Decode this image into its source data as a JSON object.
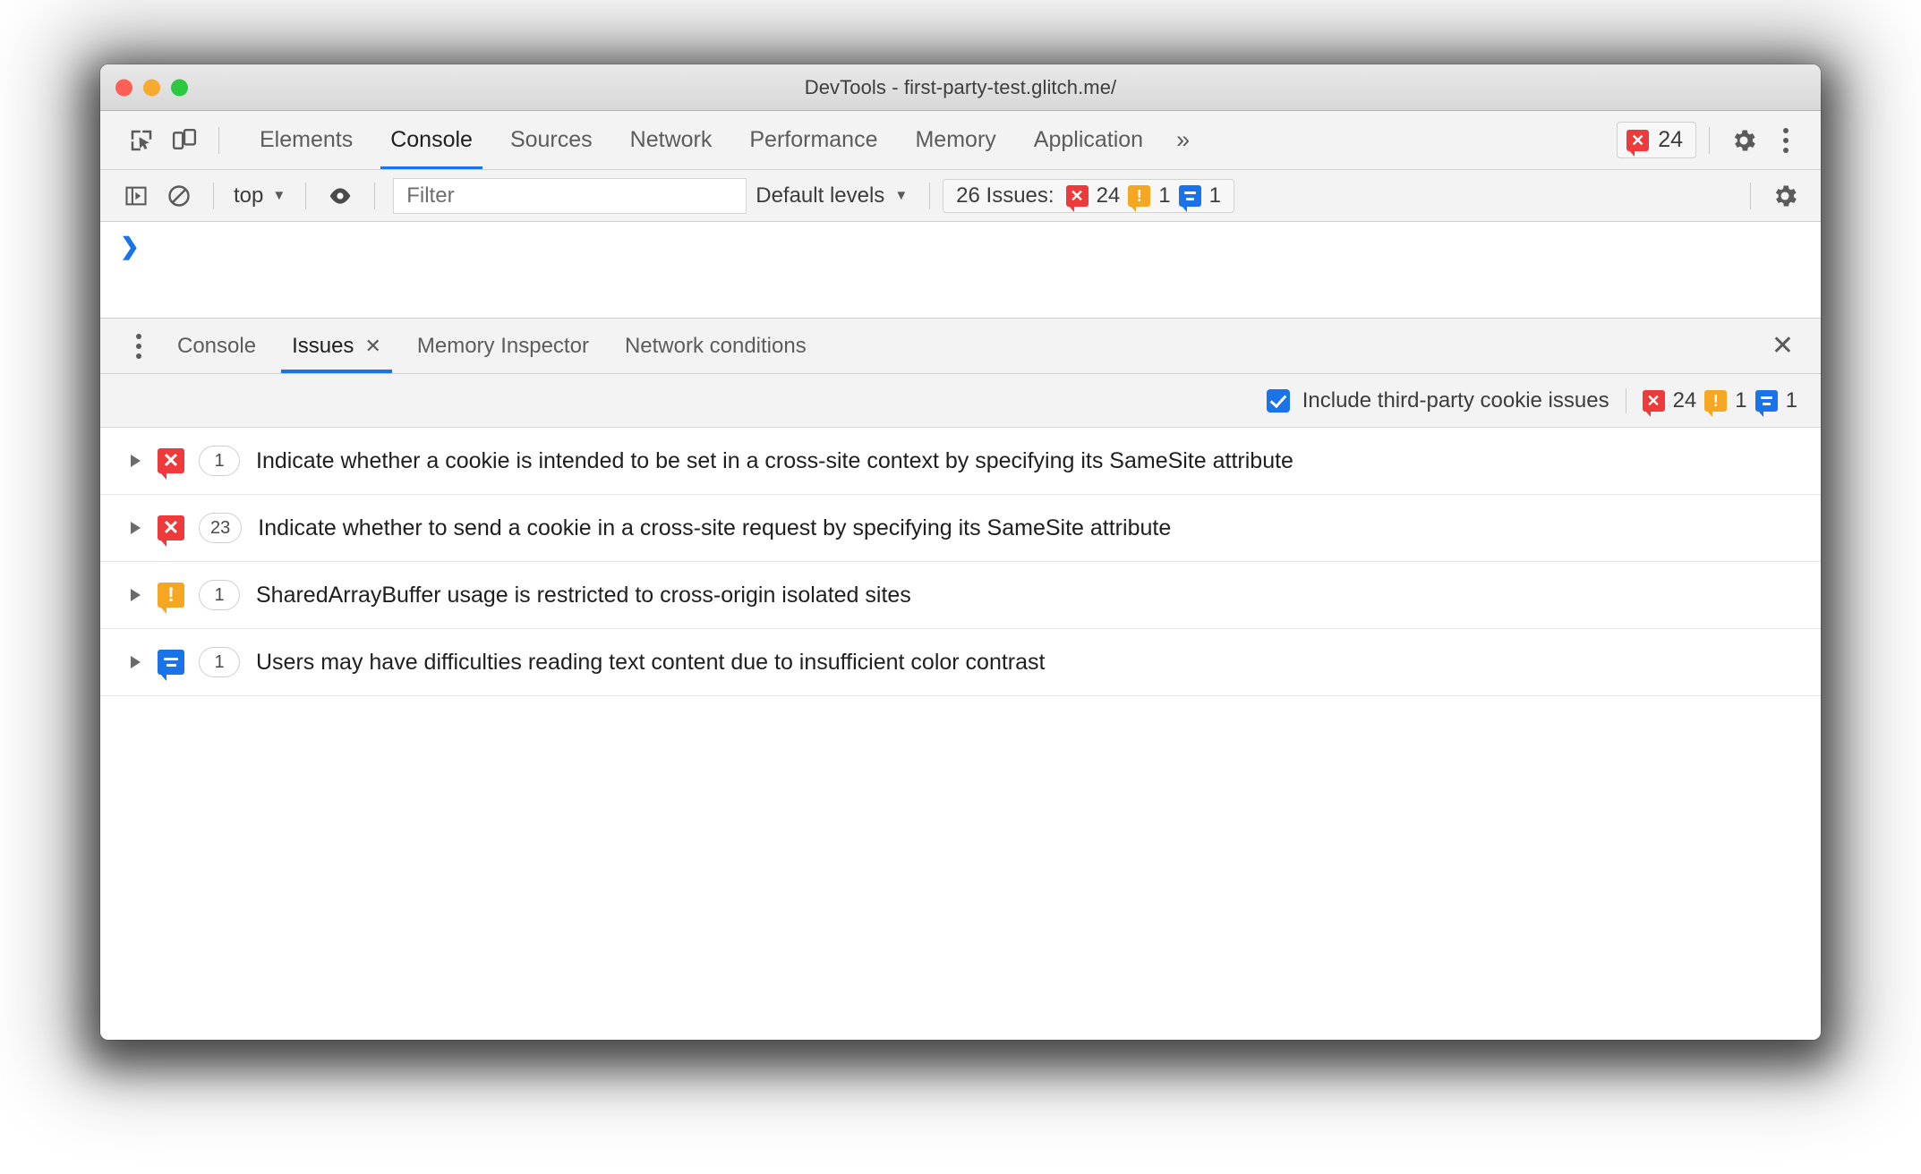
{
  "window": {
    "title": "DevTools - first-party-test.glitch.me/"
  },
  "main_tabs": {
    "items": [
      {
        "label": "Elements",
        "active": false
      },
      {
        "label": "Console",
        "active": true
      },
      {
        "label": "Sources",
        "active": false
      },
      {
        "label": "Network",
        "active": false
      },
      {
        "label": "Performance",
        "active": false
      },
      {
        "label": "Memory",
        "active": false
      },
      {
        "label": "Application",
        "active": false
      }
    ],
    "more_label": "»",
    "error_badge_count": "24",
    "inspect_icon": "inspect-element-icon",
    "device_icon": "device-toolbar-icon",
    "settings_icon": "gear-icon",
    "more_options_icon": "kebab-menu-icon"
  },
  "console_toolbar": {
    "sidebar_icon": "console-sidebar-icon",
    "clear_icon": "clear-console-icon",
    "context": "top",
    "context_caret": "▼",
    "eye_icon": "live-expression-icon",
    "filter_placeholder": "Filter",
    "levels_label": "Default levels",
    "levels_caret": "▼",
    "issues_label": "26 Issues:",
    "issues_errors": "24",
    "issues_warnings": "1",
    "issues_info": "1",
    "settings_icon": "gear-icon"
  },
  "console_body": {
    "prompt": "❯"
  },
  "drawer": {
    "kebab_icon": "drawer-menu-icon",
    "tabs": [
      {
        "label": "Console",
        "active": false,
        "closable": false
      },
      {
        "label": "Issues",
        "active": true,
        "closable": true,
        "close_glyph": "✕"
      },
      {
        "label": "Memory Inspector",
        "active": false,
        "closable": false
      },
      {
        "label": "Network conditions",
        "active": false,
        "closable": false
      }
    ],
    "close_glyph": "✕"
  },
  "issues_options": {
    "checkbox_checked": true,
    "checkbox_label": "Include third-party cookie issues",
    "errors": "24",
    "warnings": "1",
    "info": "1"
  },
  "issues": [
    {
      "severity": "error",
      "count": "1",
      "text": "Indicate whether a cookie is intended to be set in a cross-site context by specifying its SameSite attribute"
    },
    {
      "severity": "error",
      "count": "23",
      "text": "Indicate whether to send a cookie in a cross-site request by specifying its SameSite attribute"
    },
    {
      "severity": "warning",
      "count": "1",
      "text": "SharedArrayBuffer usage is restricted to cross-origin isolated sites"
    },
    {
      "severity": "info",
      "count": "1",
      "text": "Users may have difficulties reading text content due to insufficient color contrast"
    }
  ],
  "colors": {
    "error": "#ee3a3a",
    "warning": "#f5a623",
    "info": "#1a73e8",
    "accent": "#1a73e8"
  }
}
